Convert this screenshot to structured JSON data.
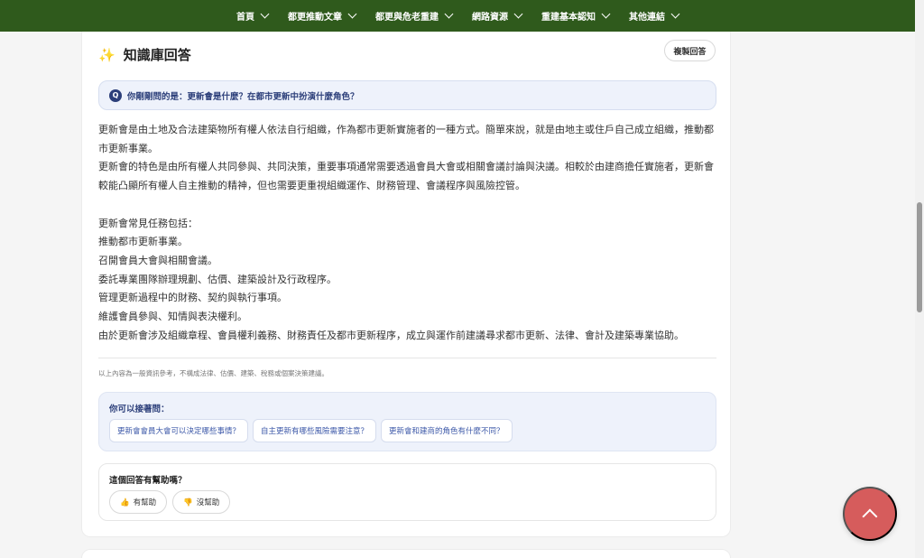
{
  "nav": {
    "items": [
      {
        "label": "首頁"
      },
      {
        "label": "都更推動文章"
      },
      {
        "label": "都更與危老重建"
      },
      {
        "label": "網路資源"
      },
      {
        "label": "重建基本認知"
      },
      {
        "label": "其他連結"
      }
    ]
  },
  "answer_card": {
    "title": "知識庫回答",
    "copy_label": "複製回答",
    "question_badge": "Q",
    "question": "你剛剛問的是：更新會是什麼？在都市更新中扮演什麼角色？",
    "paragraphs": [
      "更新會是由土地及合法建築物所有權人依法自行組織，作為都市更新實施者的一種方式。簡單來說，就是由地主或住戶自己成立組織，推動都市更新事業。",
      "更新會的特色是由所有權人共同參與、共同決策，重要事項通常需要透過會員大會或相關會議討論與決議。相較於由建商擔任實施者，更新會較能凸顯所有權人自主推動的精神，但也需要更重視組織運作、財務管理、會議程序與風險控管。"
    ],
    "tasks_intro": "更新會常見任務包括：",
    "tasks": [
      "推動都市更新事業。",
      "召開會員大會與相關會議。",
      "委託專業團隊辦理規劃、估價、建築設計及行政程序。",
      "管理更新過程中的財務、契約與執行事項。",
      "維護會員參與、知情與表決權利。",
      "由於更新會涉及組織章程、會員權利義務、財務責任及都市更新程序，成立與運作前建議尋求都市更新、法律、會計及建築專業協助。"
    ],
    "disclaimer": "以上內容為一般資訊參考，不構成法律、估價、建築、稅務或個案決策建議。",
    "followups": {
      "title": "你可以接著問：",
      "items": [
        "更新會會員大會可以決定哪些事情？",
        "自主更新有哪些風險需要注意？",
        "更新會和建商的角色有什麼不同？"
      ]
    },
    "feedback": {
      "title": "這個回答有幫助嗎？",
      "helpful": "有幫助",
      "not_helpful": "沒幫助"
    }
  },
  "icons": {
    "sparkle": "sparkle-icon",
    "thumbs_up": "thumbs-up-icon",
    "thumbs_down": "thumbs-down-icon",
    "back_to_top": "chevron-up-icon"
  },
  "colors": {
    "nav_bg": "#2f5a1c",
    "accent_blue": "#2c3f7a",
    "fab": "#d65c5c"
  }
}
